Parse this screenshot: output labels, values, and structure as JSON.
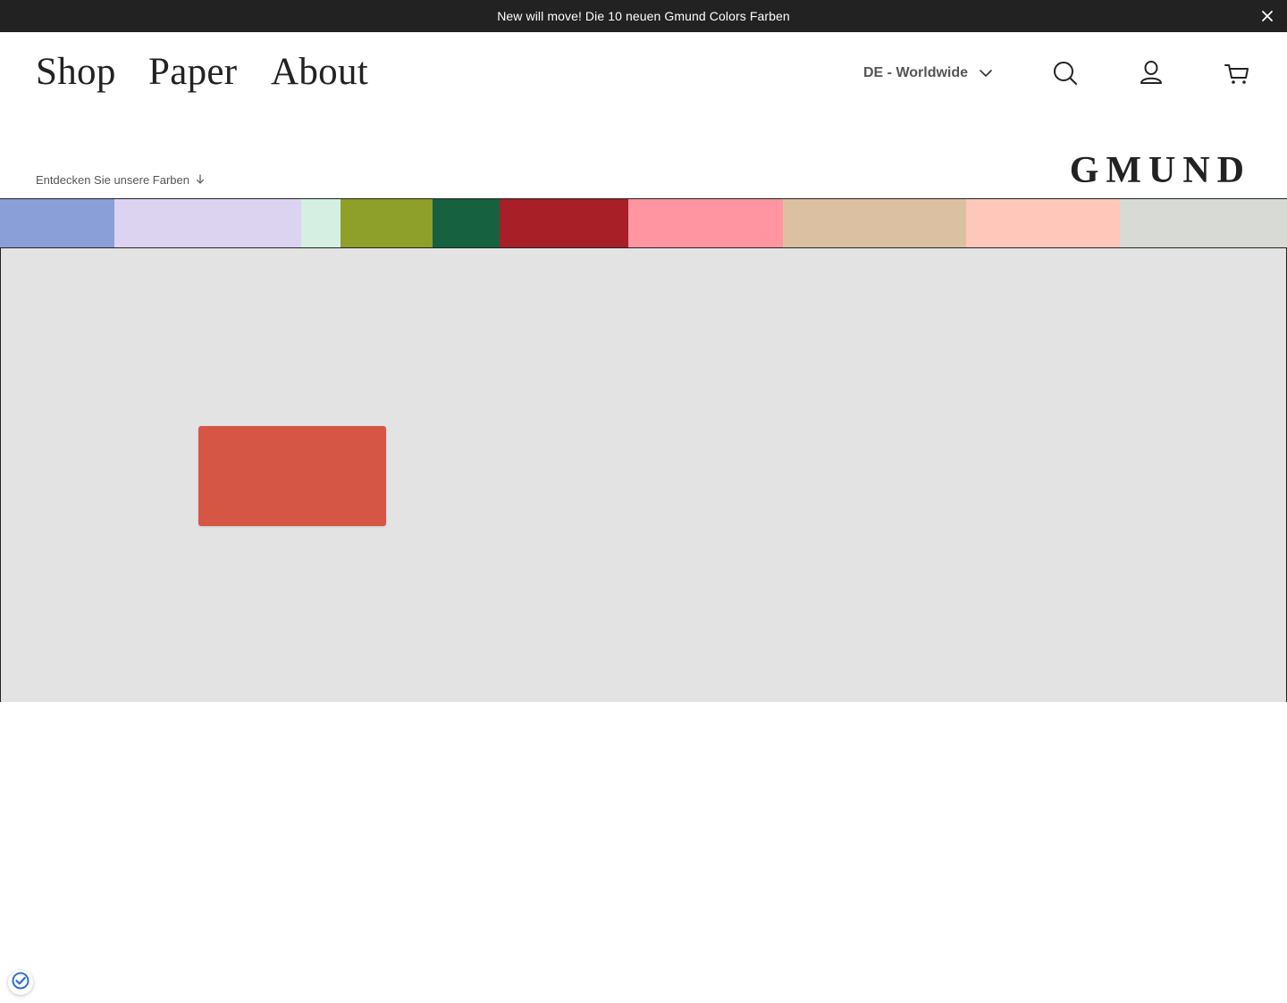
{
  "announcement": {
    "text": "New will move! Die 10 neuen Gmund Colors Farben",
    "close_icon": "close-icon"
  },
  "nav": {
    "items": [
      {
        "label": "Shop"
      },
      {
        "label": "Paper"
      },
      {
        "label": "About"
      }
    ]
  },
  "header": {
    "locale_label": "DE - Worldwide",
    "locale_icon": "chevron-down-icon",
    "icons": [
      "search-icon",
      "account-icon",
      "cart-icon"
    ]
  },
  "hero": {
    "discover_label": "Entdecken Sie unsere Farben",
    "discover_icon": "arrow-down-icon",
    "brand": "GMUND",
    "stage_color": "#e3e3e3",
    "card_color": "#d55645"
  },
  "swatches": [
    {
      "color": "#8a9ed8"
    },
    {
      "color": "#dcd3f0"
    },
    {
      "color": "#d5efe2"
    },
    {
      "color": "#8e9f2a"
    },
    {
      "color": "#166240"
    },
    {
      "color": "#a81f28"
    },
    {
      "color": "#ff95a0"
    },
    {
      "color": "#dbc1a2"
    },
    {
      "color": "#ffc6ba"
    },
    {
      "color": "#d8dad6"
    }
  ],
  "consent": {
    "icon": "privacy-check-icon"
  }
}
